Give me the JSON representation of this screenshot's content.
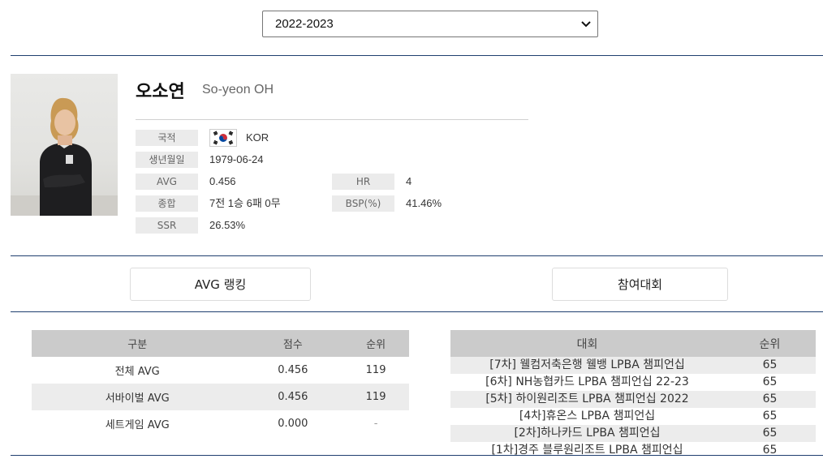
{
  "season_select": {
    "value": "2022-2023"
  },
  "player": {
    "name_ko": "오소연",
    "name_en": "So-yeon OH",
    "fields": {
      "nationality_label": "국적",
      "nationality_value": "KOR",
      "birth_label": "생년월일",
      "birth_value": "1979-06-24",
      "avg_label": "AVG",
      "avg_value": "0.456",
      "hr_label": "HR",
      "hr_value": "4",
      "total_label": "종합",
      "total_value": "7전 1승 6패 0무",
      "bsp_label": "BSP(%)",
      "bsp_value": "41.46%",
      "ssr_label": "SSR",
      "ssr_value": "26.53%"
    },
    "flag_icon": "south-korea-flag-icon"
  },
  "tabs": {
    "avg_ranking": "AVG 랭킹",
    "tournaments": "참여대회"
  },
  "ranking_table": {
    "headers": [
      "구분",
      "점수",
      "순위"
    ],
    "rows": [
      [
        "전체 AVG",
        "0.456",
        "119"
      ],
      [
        "서바이벌 AVG",
        "0.456",
        "119"
      ],
      [
        "세트게임 AVG",
        "0.000",
        "-"
      ]
    ]
  },
  "tournament_table": {
    "headers": [
      "대회",
      "순위"
    ],
    "rows": [
      [
        "[7차] 웰컴저축은행 웰뱅 LPBA 챔피언십",
        "65"
      ],
      [
        "[6차] NH농협카드 LPBA 챔피언십 22-23",
        "65"
      ],
      [
        "[5차] 하이원리조트 LPBA 챔피언십 2022",
        "65"
      ],
      [
        "[4차]휴온스 LPBA 챔피언십",
        "65"
      ],
      [
        "[2차]하나카드 LPBA 챔피언십",
        "65"
      ],
      [
        "[1차]경주 블루원리조트 LPBA 챔피언십",
        "65"
      ]
    ]
  },
  "colors": {
    "divider": "#1f3f6f",
    "header_bg": "#cbcbcb",
    "label_bg": "#ebebeb"
  }
}
